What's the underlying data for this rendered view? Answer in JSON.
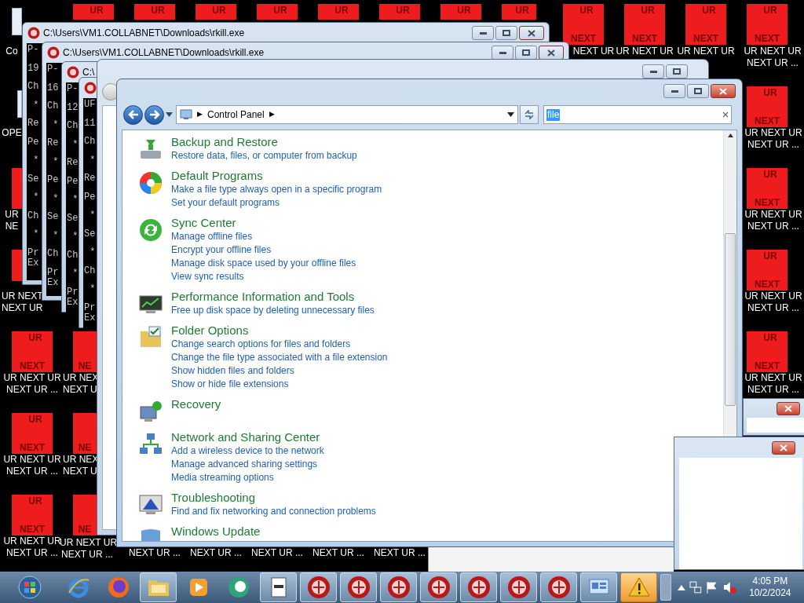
{
  "desktop_icons": [
    {
      "kind": "generic",
      "label": [
        "Co"
      ]
    },
    {
      "kind": "red_top",
      "top": "UR"
    },
    {
      "kind": "red_top",
      "top": "UR"
    },
    {
      "kind": "red_top",
      "top": "UR"
    },
    {
      "kind": "red_top",
      "top": "UR"
    },
    {
      "kind": "red_top",
      "top": "UR"
    },
    {
      "kind": "red_top",
      "top": "UR"
    },
    {
      "kind": "red_top",
      "top": "UR"
    },
    {
      "kind": "red_top",
      "top": "UR"
    },
    {
      "kind": "red",
      "top": "UR",
      "bottom": "NEXT",
      "label": [
        "NEXT UR"
      ]
    },
    {
      "kind": "red",
      "top": "UR",
      "bottom": "NEXT",
      "label": [
        "UR NEXT UR"
      ]
    },
    {
      "kind": "red",
      "top": "UR",
      "bottom": "NEXT",
      "label": [
        "UR NEXT UR"
      ]
    },
    {
      "kind": "red",
      "top": "UR",
      "bottom": "NEXT",
      "label": [
        "UR NEXT UR",
        "NEXT UR ..."
      ]
    },
    {
      "kind": "generic",
      "label": [
        "OPE"
      ]
    },
    {
      "kind": "red",
      "top": "UR",
      "bottom": "NEXT",
      "label": [
        "UR NEXT UR",
        "NEXT UR ..."
      ]
    },
    {
      "kind": "red",
      "label": [
        "UR",
        "NE"
      ]
    },
    {
      "kind": "red",
      "top": "UR",
      "bottom": "NEXT",
      "label": [
        "UR NEXT UR",
        "NEXT UR ..."
      ]
    },
    {
      "kind": "red",
      "label": [
        "UR NEXT",
        "NEXT UR"
      ]
    },
    {
      "kind": "red",
      "top": "UR",
      "bottom": "NEXT",
      "label": [
        "UR NEXT UR",
        "NEXT UR ..."
      ]
    },
    {
      "kind": "red",
      "top": "UR",
      "bottom": "NEXT",
      "label": [
        "UR NEXT UR",
        "NEXT UR ..."
      ]
    },
    {
      "kind": "red",
      "bottom": "NE",
      "label": [
        "UR NEX",
        "NEXT U"
      ]
    },
    {
      "kind": "red",
      "top": "UR",
      "bottom": "NEXT",
      "label": [
        "UR NEXT UR",
        "NEXT UR ..."
      ]
    },
    {
      "kind": "red",
      "top": "UR",
      "bottom": "NEXT",
      "label": [
        "UR NEXT UR",
        "NEXT UR ..."
      ]
    },
    {
      "kind": "red",
      "bottom": "NE",
      "label": [
        "UR NEX",
        "NEXT U"
      ]
    },
    {
      "kind": "red",
      "top": "UR",
      "bottom": "NEXT",
      "label": [
        "UR NEXT UR",
        "NEXT UR ..."
      ]
    },
    {
      "kind": "red",
      "bottom": "NE",
      "label": [
        "UR NEXT UR",
        "NEXT UR ..."
      ]
    },
    {
      "kind": "label_only",
      "label": [
        "NEXT UR ..."
      ]
    },
    {
      "kind": "label_only",
      "label": [
        "NEXT UR ..."
      ]
    },
    {
      "kind": "label_only",
      "label": [
        "NEXT UR ..."
      ]
    },
    {
      "kind": "label_only",
      "label": [
        "NEXT UR ..."
      ]
    },
    {
      "kind": "label_only",
      "label": [
        "NEXT UR ..."
      ]
    }
  ],
  "consoles": [
    {
      "title": "C:\\Users\\VM1.COLLABNET\\Downloads\\rkill.exe",
      "lines": [
        "P-",
        "19",
        "Ch",
        " *",
        "Re",
        "Pe",
        " *",
        "Se",
        " *",
        "Ch",
        " *",
        "Pr\nEx"
      ]
    },
    {
      "title": "C:\\Users\\VM1.COLLABNET\\Downloads\\rkill.exe",
      "lines": [
        "P-",
        "16",
        "Ch",
        " *",
        "Re",
        " *",
        "Pe",
        " *",
        "Se",
        " *",
        "Ch",
        "Pr\nEx"
      ]
    },
    {
      "title": "C:\\",
      "lines": [
        "P-",
        "12",
        "Ch",
        " *",
        "Re",
        "Pe",
        " *",
        "Se",
        " *",
        "Ch",
        " *",
        "Pr\nEx"
      ]
    },
    {
      "lines": [
        "UF",
        "11",
        "Ch",
        " *",
        "Re",
        "Pe",
        " *",
        "Se",
        " *",
        "Ch",
        " *",
        "Pr\nEx"
      ]
    }
  ],
  "control_panel": {
    "breadcrumb": [
      "Control Panel"
    ],
    "separator": "▶",
    "search": {
      "value": "file"
    },
    "items": [
      {
        "kind": "backup",
        "title": "Backup and Restore",
        "links": [
          "Restore data, files, or computer from backup"
        ]
      },
      {
        "kind": "programs",
        "title": "Default Programs",
        "links": [
          "Make a file type always open in a specific program",
          "Set your default programs"
        ]
      },
      {
        "kind": "sync",
        "title": "Sync Center",
        "links": [
          "Manage offline files",
          "Encrypt your offline files",
          "Manage disk space used by your offline files",
          "View sync results"
        ]
      },
      {
        "kind": "performance",
        "title": "Performance Information and Tools",
        "links": [
          "Free up disk space by deleting unnecessary files"
        ]
      },
      {
        "kind": "folder",
        "title": "Folder Options",
        "links": [
          "Change search options for files and folders",
          "Change the file type associated with a file extension",
          "Show hidden files and folders",
          "Show or hide file extensions"
        ]
      },
      {
        "kind": "recovery",
        "title": "Recovery"
      },
      {
        "kind": "network",
        "title": "Network and Sharing Center",
        "links": [
          "Add a wireless device to the network",
          "Manage advanced sharing settings",
          "Media streaming options"
        ]
      },
      {
        "kind": "troubleshoot",
        "title": "Troubleshooting",
        "links": [
          "Find and fix networking and connection problems"
        ]
      },
      {
        "kind": "update",
        "title": "Windows Update"
      }
    ]
  },
  "taskbar": {
    "items": [
      {
        "kind": "start",
        "running": false
      },
      {
        "kind": "ie",
        "running": false
      },
      {
        "kind": "firefox",
        "running": false
      },
      {
        "kind": "folder",
        "running": true
      },
      {
        "kind": "media",
        "running": false
      },
      {
        "kind": "green",
        "running": false
      },
      {
        "kind": "notepad",
        "running": true
      },
      {
        "kind": "rkill",
        "running": true
      },
      {
        "kind": "rkill",
        "running": true
      },
      {
        "kind": "rkill",
        "running": true
      },
      {
        "kind": "rkill",
        "running": true
      },
      {
        "kind": "rkill",
        "running": true
      },
      {
        "kind": "rkill",
        "running": true
      },
      {
        "kind": "rkill",
        "running": true
      },
      {
        "kind": "network",
        "running": true
      },
      {
        "kind": "warning",
        "running": true
      }
    ],
    "clock": {
      "time": "4:05 PM",
      "date": "10/2/2024"
    }
  }
}
